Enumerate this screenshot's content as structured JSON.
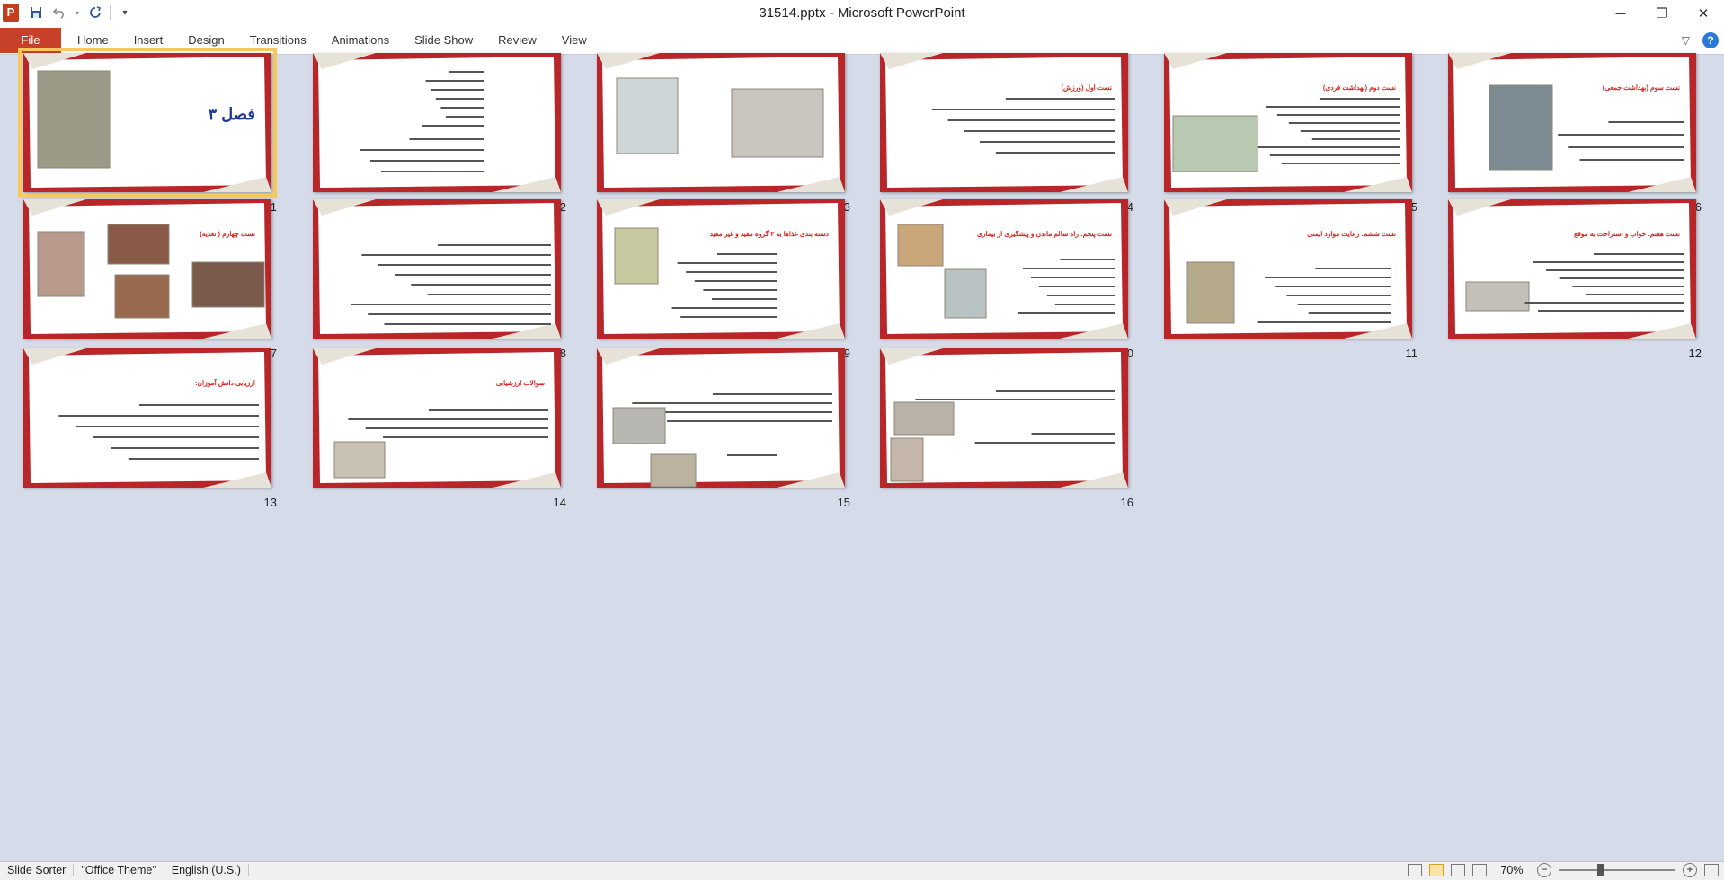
{
  "titlebar": {
    "app_icon": "P",
    "title": "31514.pptx  -  Microsoft PowerPoint",
    "qat": [
      "save-icon",
      "undo-icon",
      "redo-icon",
      "customize-icon"
    ],
    "window_controls": [
      "─",
      "❐",
      "✕"
    ]
  },
  "ribbon": {
    "file_tab": "File",
    "tabs": [
      "Home",
      "Insert",
      "Design",
      "Transitions",
      "Animations",
      "Slide Show",
      "Review",
      "View"
    ],
    "help": "?"
  },
  "slides": [
    {
      "num": "1",
      "title": "فصل ۳",
      "selected": true
    },
    {
      "num": "2",
      "title": ""
    },
    {
      "num": "3",
      "title": ""
    },
    {
      "num": "4",
      "title": "نست اول (ورزش)"
    },
    {
      "num": "5",
      "title": "نست دوم (بهداشت فردی)"
    },
    {
      "num": "6",
      "title": "نست سوم (بهداشت جمعی)"
    },
    {
      "num": "7",
      "title": "نست چهارم ( تغذیه)"
    },
    {
      "num": "8",
      "title": ""
    },
    {
      "num": "9",
      "title": "دسته بندی غذاها به ۴ گروه مفید و غیر مفید"
    },
    {
      "num": "10",
      "title": "نست پنجم: راه سالم ماندن و پیشگیری از بیماری"
    },
    {
      "num": "11",
      "title": "نست ششم: رعایت موارد ایمنی"
    },
    {
      "num": "12",
      "title": "نست هفتم: خواب و استراحت به موقع"
    },
    {
      "num": "13",
      "title": "ارزیابی دانش آموزان:"
    },
    {
      "num": "14",
      "title": "سوالات ارزشیابی"
    },
    {
      "num": "15",
      "title": ""
    },
    {
      "num": "16",
      "title": ""
    }
  ],
  "statusbar": {
    "slide_mode": "Slide Sorter",
    "theme": "\"Office Theme\"",
    "language": "English (U.S.)",
    "zoom": "70%",
    "zoom_level": 0.35
  },
  "colors": {
    "file_tab": "#c7402a",
    "slide_frame_red": "#b8262a",
    "title_red": "#e02020",
    "selection": "#f6c85f",
    "sorter_bg": "#d6dbe9"
  }
}
